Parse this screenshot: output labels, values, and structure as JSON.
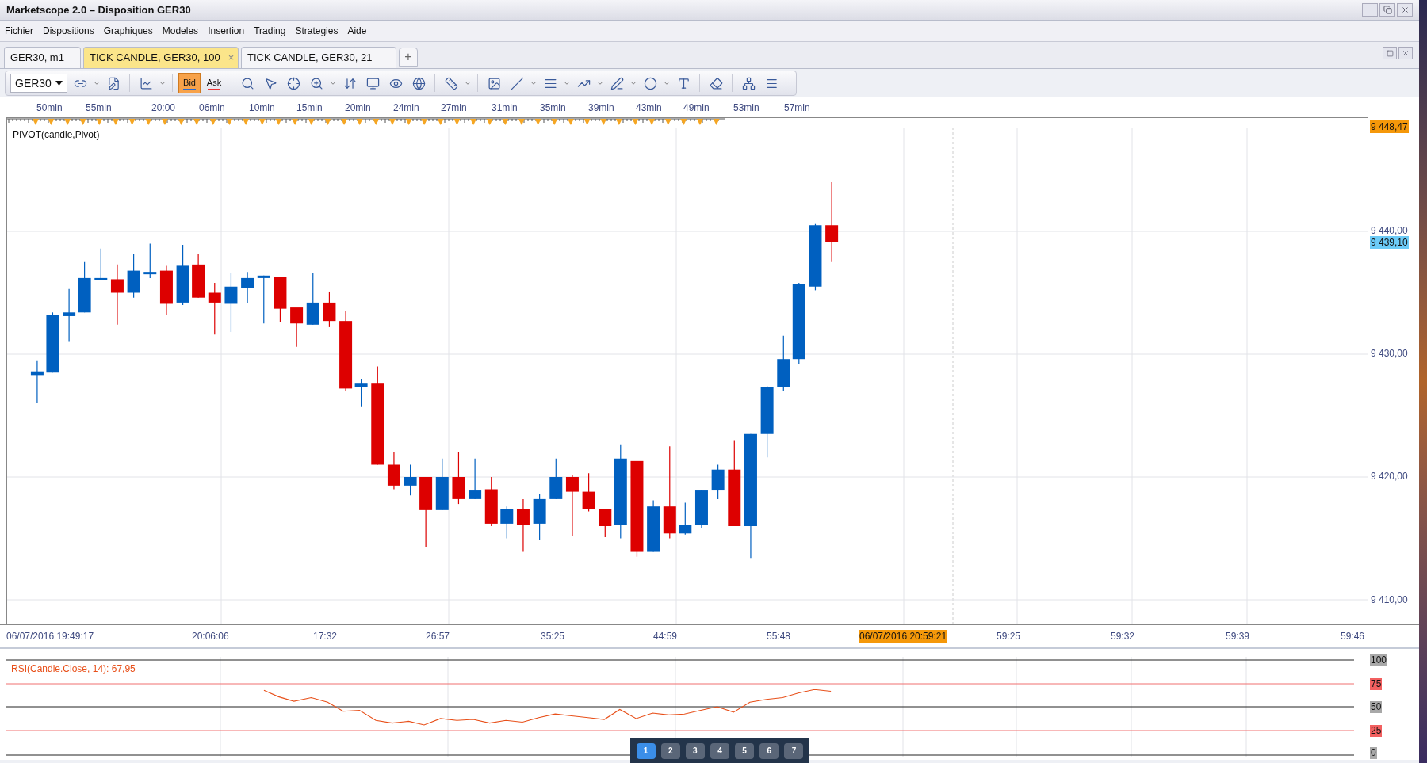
{
  "window": {
    "title": "Marketscope 2.0 – Disposition GER30"
  },
  "menu": [
    "Fichier",
    "Dispositions",
    "Graphiques",
    "Modeles",
    "Insertion",
    "Trading",
    "Strategies",
    "Aide"
  ],
  "tabs": [
    {
      "label": "GER30, m1",
      "selected": false
    },
    {
      "label": "TICK CANDLE, GER30, 100",
      "selected": true,
      "close": "×"
    },
    {
      "label": "TICK CANDLE, GER30, 21",
      "selected": false
    }
  ],
  "new_tab": "+",
  "toolbar": {
    "symbol": "GER30",
    "price_buttons": [
      {
        "label": "Bid",
        "selected": true
      },
      {
        "label": "Ask",
        "selected": false
      }
    ]
  },
  "top_axis": [
    "50min",
    "55min",
    "20:00",
    "06min",
    "10min",
    "15min",
    "20min",
    "24min",
    "27min",
    "31min",
    "35min",
    "39min",
    "43min",
    "49min",
    "53min",
    "57min"
  ],
  "chart": {
    "indicator_label": "PIVOT(candle,Pivot)",
    "price_labels": [
      {
        "text": "9 448,47",
        "kind": "high"
      },
      {
        "text": "9 440,00",
        "kind": "tick"
      },
      {
        "text": "9 439,10",
        "kind": "current"
      },
      {
        "text": "9 430,00",
        "kind": "tick"
      },
      {
        "text": "9 420,00",
        "kind": "tick"
      },
      {
        "text": "9 410,00",
        "kind": "tick"
      }
    ]
  },
  "bottom_axis": [
    {
      "text": "06/07/2016 19:49:17",
      "kind": "tick"
    },
    {
      "text": "20:06:06",
      "kind": "tick"
    },
    {
      "text": "17:32",
      "kind": "tick"
    },
    {
      "text": "26:57",
      "kind": "tick"
    },
    {
      "text": "35:25",
      "kind": "tick"
    },
    {
      "text": "44:59",
      "kind": "tick"
    },
    {
      "text": "55:48",
      "kind": "tick"
    },
    {
      "text": "06/07/2016 20:59:21",
      "kind": "cursor"
    },
    {
      "text": "59:25",
      "kind": "tick"
    },
    {
      "text": "59:32",
      "kind": "tick"
    },
    {
      "text": "59:39",
      "kind": "tick"
    },
    {
      "text": "59:46",
      "kind": "tick"
    }
  ],
  "rsi": {
    "label": "RSI(Candle.Close, 14): 67,95",
    "levels": [
      {
        "text": "100",
        "kind": "bound"
      },
      {
        "text": "75",
        "kind": "threshold"
      },
      {
        "text": "50",
        "kind": "bound"
      },
      {
        "text": "25",
        "kind": "threshold"
      },
      {
        "text": "0",
        "kind": "bound"
      }
    ]
  },
  "taskbar": [
    {
      "label": "1",
      "selected": true
    },
    {
      "label": "2",
      "selected": false
    },
    {
      "label": "3",
      "selected": false
    },
    {
      "label": "4",
      "selected": false
    },
    {
      "label": "5",
      "selected": false
    },
    {
      "label": "6",
      "selected": false
    },
    {
      "label": "7",
      "selected": false
    }
  ]
}
